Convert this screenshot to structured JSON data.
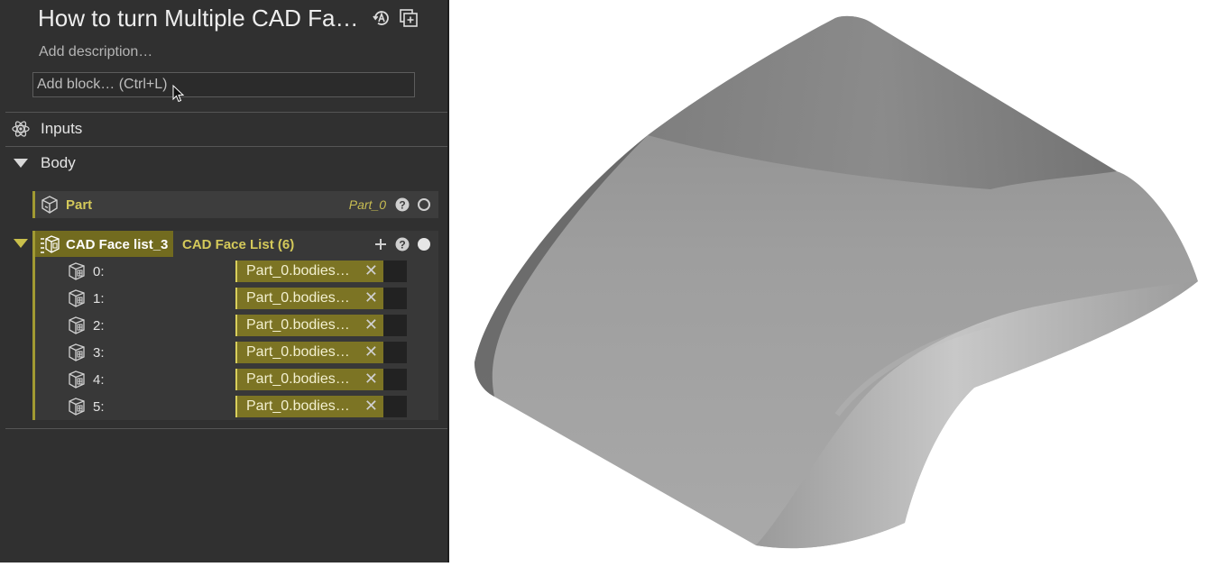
{
  "header": {
    "title": "How to turn Multiple CAD Fa…",
    "description_placeholder": "Add description…",
    "add_block_placeholder": "Add block… (Ctrl+L)"
  },
  "sections": {
    "inputs_label": "Inputs",
    "body_label": "Body"
  },
  "part_block": {
    "label": "Part",
    "value": "Part_0"
  },
  "cad_block": {
    "name": "CAD Face list_3",
    "type": "CAD Face List (6)",
    "rows": [
      {
        "index": "0:",
        "value": "Part_0.bodies…"
      },
      {
        "index": "1:",
        "value": "Part_0.bodies…"
      },
      {
        "index": "2:",
        "value": "Part_0.bodies…"
      },
      {
        "index": "3:",
        "value": "Part_0.bodies…"
      },
      {
        "index": "4:",
        "value": "Part_0.bodies…"
      },
      {
        "index": "5:",
        "value": "Part_0.bodies…"
      }
    ]
  },
  "colors": {
    "panel_bg": "#303030",
    "accent": "#a19a32",
    "chip": "#7c7424"
  },
  "icons": [
    "reload-a-icon",
    "duplicate-icon",
    "atom-inputs-icon",
    "triangle-down-icon",
    "part-cube-icon",
    "face-list-icon",
    "face-cube-icon",
    "help-icon",
    "radio-icon",
    "plus-icon",
    "close-icon",
    "pointer-cursor-icon"
  ]
}
